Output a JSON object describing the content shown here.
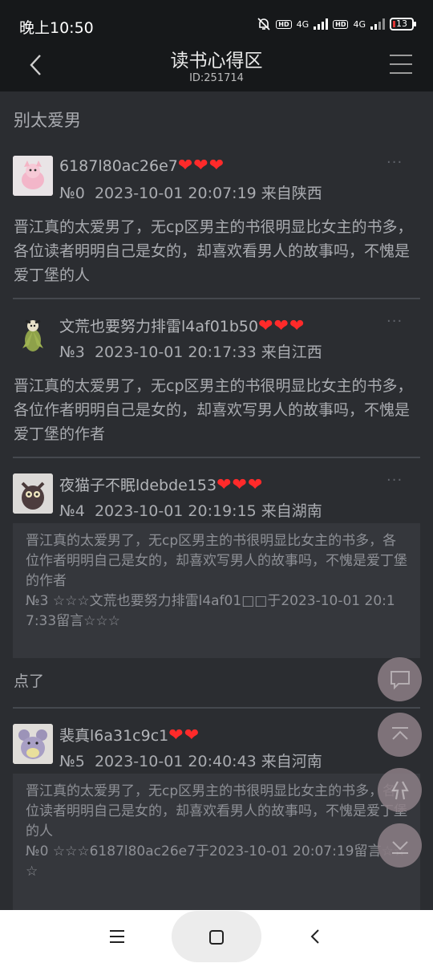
{
  "status": {
    "time": "晚上10:50",
    "net1": "4G",
    "net2": "4G",
    "hd": "HD",
    "battery": "13"
  },
  "header": {
    "title": "读书心得区",
    "subtitle": "ID:251714"
  },
  "topic": "别太爱男",
  "posts": [
    {
      "username": "6187l80ac26e7",
      "hearts": "❤❤❤",
      "number": "№0",
      "datetime": "2023-10-01 20:07:19",
      "location": "来自陕西",
      "body": "晋江真的太爱男了，无cp区男主的书很明显比女主的书多，各位读者明明自己是女的，却喜欢看男人的故事吗，不愧是爱丁堡的人"
    },
    {
      "username": "文荒也要努力排雷l4af01b50",
      "hearts": "❤❤❤",
      "number": "№3",
      "datetime": "2023-10-01 20:17:33",
      "location": "来自江西",
      "body": "晋江真的太爱男了，无cp区男主的书很明显比女主的书多，各位作者明明自己是女的，却喜欢写男人的故事吗，不愧是爱丁堡的作者"
    },
    {
      "username": "夜猫子不眠ldebde153",
      "hearts": "❤❤❤",
      "number": "№4",
      "datetime": "2023-10-01 20:19:15",
      "location": "来自湖南",
      "quote_text": "晋江真的太爱男了，无cp区男主的书很明显比女主的书多，各位作者明明自己是女的，却喜欢写男人的故事吗，不愧是爱丁堡的作者",
      "quote_ref": "№3 ☆☆☆文荒也要努力排雷l4af01□□于2023-10-01 20:17:33留言☆☆☆",
      "body": "点了"
    },
    {
      "username": "裴真l6a31c9c1",
      "hearts": "❤❤",
      "number": "№5",
      "datetime": "2023-10-01 20:40:43",
      "location": "来自河南",
      "quote_text": "晋江真的太爱男了，无cp区男主的书很明显比女主的书多，各位读者明明自己是女的，却喜欢看男人的故事吗，不愧是爱丁堡的人",
      "quote_ref": "№0 ☆☆☆6187l80ac26e7于2023-10-01 20:07:19留言☆☆☆"
    }
  ],
  "more_glyph": "···",
  "colors": {
    "page_bg": "#2b2d31",
    "bar_bg": "#16181a",
    "quote_bg": "#35373c",
    "heart": "#ff2a2a",
    "fab": "#8d7f86"
  }
}
